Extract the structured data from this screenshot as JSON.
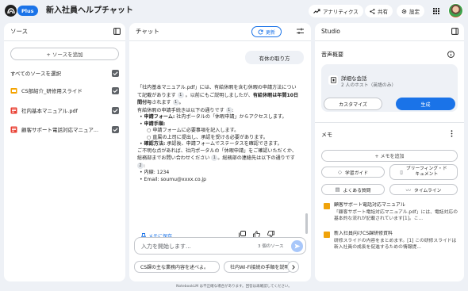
{
  "header": {
    "plus_badge": "Plus",
    "title": "新入社員ヘルプチャット",
    "analytics_label": "アナリティクス",
    "share_label": "共有",
    "settings_label": "設定"
  },
  "sources": {
    "title": "ソース",
    "add_label": "+ ソースを追加",
    "select_all_label": "すべてのソースを選択",
    "items": [
      {
        "label": "CS部紹介_研修用スライド",
        "icon": "slides-icon",
        "color": "#f4a300"
      },
      {
        "label": "社内基本マニュアル.pdf",
        "icon": "pdf-icon",
        "color": "#e94235"
      },
      {
        "label": "顧客サポート電話対応マニュア...",
        "icon": "pdf-icon",
        "color": "#e94235"
      }
    ]
  },
  "chat": {
    "title": "チャット",
    "refresh_label": "更新",
    "user_message": "有休の取り方",
    "answer": {
      "p1a": "「社内基本マニュアル.pdf」には、有給休暇を含む休暇の申請方法について記載があります",
      "p1b": "。以前にもご説明しましたが、",
      "p1c_bold": "有給休暇は年間10日間付与",
      "p1d": "されます",
      "p2": "有給休暇の申請手続きは以下の通りです",
      "b1_bold": "申請フォーム:",
      "b1": " 社内ポータルの「休暇申請」からアクセスします。",
      "b2_bold": "申請手順:",
      "b2a": "申請フォームに必要事項を記入します。",
      "b2b": "直属の上司に提出し、承認を受ける必要があります。",
      "b3_bold": "確認方法:",
      "b3": " 承認後、申請フォームでステータスを確認できます。",
      "p3a": "ご不明な点があれば、社内ポータルの「休暇申請」をご確認いただくか、総務部までお問い合わせください",
      "p3b": "。総務部の連絡先は以下の通りです",
      "ext": "内線: 1234",
      "email": "Email: soumu@xxxx.co.jp",
      "cites": [
        "1",
        "1",
        "1",
        "1",
        "2"
      ]
    },
    "save_memo_label": "メモに保存",
    "input_placeholder": "入力を開始します...",
    "source_count": "3 個のソース",
    "suggestions": [
      "CS課の主な業務内容を述べよ。",
      "社内Wi-Fi接続の手順を説明"
    ]
  },
  "studio": {
    "title": "Studio",
    "audio_title": "音声概要",
    "audio_card_title": "詳細な会話",
    "audio_card_subtitle": "2 人のホスト（英語のみ）",
    "customize_label": "カスタマイズ",
    "generate_label": "生成",
    "memo_title": "メモ",
    "add_memo_label": "+ メモを追加",
    "chips": [
      {
        "label": "学習ガイド",
        "icon": "study-guide-icon"
      },
      {
        "label": "ブリーフィング・ドキュメント",
        "icon": "briefing-doc-icon"
      },
      {
        "label": "よくある質問",
        "icon": "faq-icon"
      },
      {
        "label": "タイムライン",
        "icon": "timeline-icon"
      }
    ],
    "notes": [
      {
        "title": "顧客サポート電話対応マニュアル",
        "body": "「顧客サポート電話対応マニュアル.pdf」には、電話対応の基本的な流れが記載されています[1]。こ..."
      },
      {
        "title": "新入社員向けCS課研修資料",
        "body": "研修スライドの内容をまとめます。[1] この研修スライドは新入社員の成長を促進するための情報提..."
      }
    ]
  },
  "footer": "NotebookLM は不正確な場合があります。回答は再確認してください。",
  "colors": {
    "accent": "#1a73e8",
    "background": "#eef1f6",
    "note_icon": "#f0a30a"
  }
}
